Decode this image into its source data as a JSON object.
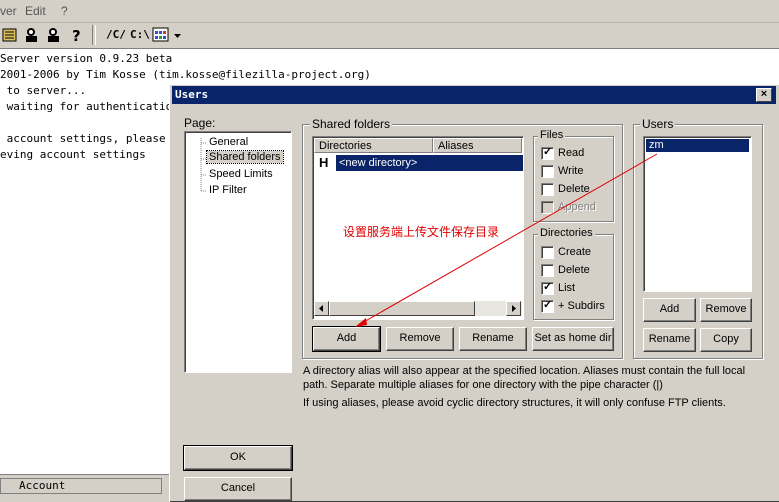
{
  "menubar": {
    "items": [
      "ver",
      "Edit",
      "?"
    ]
  },
  "toolbar": {
    "path1": "/C/",
    "path2": "C:\\"
  },
  "log": {
    "lines": [
      "Server version 0.9.23 beta",
      "2001-2006 by Tim Kosse (tim.kosse@filezilla-project.org)",
      " to server...",
      " waiting for authentication",
      "",
      " account settings, please wai",
      "eving account settings"
    ]
  },
  "statusbar": {
    "account_header": "Account"
  },
  "dialog": {
    "title": "Users",
    "close": "×",
    "page_label": "Page:",
    "pages": [
      "General",
      "Shared folders",
      "Speed Limits",
      "IP Filter"
    ],
    "selected_page": "Shared folders",
    "shared_folders": {
      "group_label": "Shared folders",
      "col_directories": "Directories",
      "col_aliases": "Aliases",
      "rows": [
        {
          "flag": "H",
          "directory": "<new directory>"
        }
      ],
      "annotation": "设置服务端上传文件保存目录",
      "buttons": {
        "add": "Add",
        "remove": "Remove",
        "rename": "Rename",
        "set_home": "Set as home dir"
      }
    },
    "files": {
      "label": "Files",
      "options": [
        {
          "label": "Read",
          "checked": true,
          "enabled": true
        },
        {
          "label": "Write",
          "checked": false,
          "enabled": true
        },
        {
          "label": "Delete",
          "checked": false,
          "enabled": true
        },
        {
          "label": "Append",
          "checked": false,
          "enabled": false
        }
      ]
    },
    "directories": {
      "label": "Directories",
      "options": [
        {
          "label": "Create",
          "checked": false
        },
        {
          "label": "Delete",
          "checked": false
        },
        {
          "label": "List",
          "checked": true
        },
        {
          "label": "+ Subdirs",
          "checked": true
        }
      ]
    },
    "users": {
      "label": "Users",
      "items": [
        "zm"
      ],
      "buttons": {
        "add": "Add",
        "remove": "Remove",
        "rename": "Rename",
        "copy": "Copy"
      }
    },
    "info_text_1": "A directory alias will also appear at the specified location. Aliases must contain the full local",
    "info_text_2": "path. Separate multiple aliases for one directory with the pipe character (|)",
    "info_text_3": "If using aliases, please avoid cyclic directory structures, it will only confuse FTP clients.",
    "ok": "OK",
    "cancel": "Cancel",
    "colors": {
      "titlebar": "#0a246a",
      "annotation": "#e00000"
    }
  }
}
